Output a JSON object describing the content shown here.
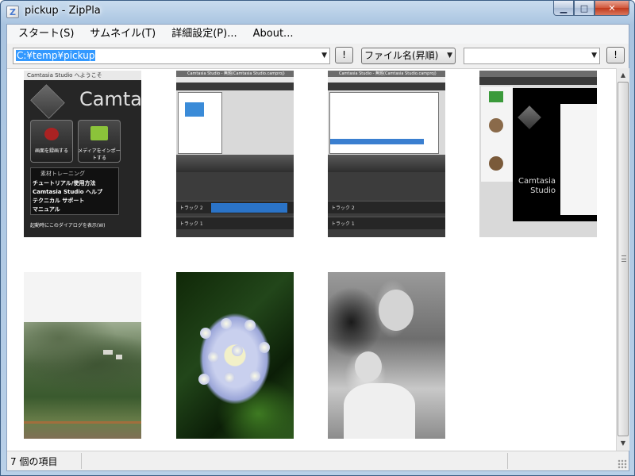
{
  "window": {
    "title": "pickup - ZipPla",
    "icon_glyph": "Z",
    "min_glyph": "▁",
    "max_glyph": "□",
    "close_glyph": "✕"
  },
  "menu": {
    "items": [
      "スタート(S)",
      "サムネイル(T)",
      "詳細設定(P)...",
      "About..."
    ]
  },
  "toolbar": {
    "path_value": "C:¥temp¥pickup",
    "sort_value": "ファイル名(昇順)",
    "filter_value": "",
    "exec_glyph": "!",
    "dropdown_glyph": "▼"
  },
  "thumbnails": {
    "welcome": {
      "window_title": "Camtasia Studio へようこそ",
      "brand": "Camtasia",
      "tile1_label": "画面を録画する",
      "tile2_label": "メディアをインポートする",
      "menu_header": "素材トレーニング",
      "menu_lines": [
        "チュートリアル/使用方法",
        "Camtasia Studio ヘルプ",
        "テクニカル サポート",
        "マニュアル"
      ],
      "footer": "起動時にこのダイアログを表示(W)"
    },
    "studio_title": "Camtasia Studio - 無題(Camtasia Studio.camproj)",
    "track1": "トラック 1",
    "track2": "トラック 2",
    "wizard_brand": "Camtasia Studio"
  },
  "status": {
    "text": "7 個の項目"
  }
}
